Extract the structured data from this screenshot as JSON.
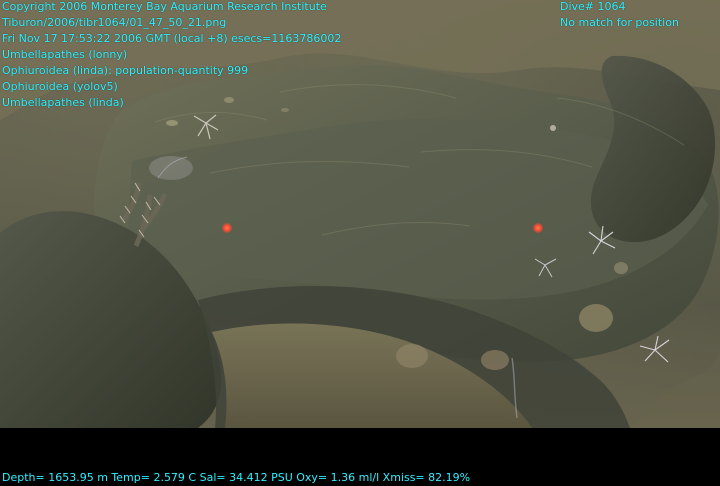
{
  "overlay": {
    "lines": [
      "Copyright 2006 Monterey Bay Aquarium Research Institute",
      "Tiburon/2006/tibr1064/01_47_50_21.png",
      "Fri Nov 17 17:53:22 2006 GMT (local +8)  esecs=1163786002",
      "Umbellapathes (lonny)",
      "Ophiuroidea (linda): population-quantity 999",
      "Ophiuroidea (yolov5)",
      "Umbellapathes (linda)"
    ],
    "right_lines": [
      "Dive# 1064",
      "No match for position"
    ],
    "bottom_line": "Depth= 1653.95 m  Temp= 2.579 C  Sal= 34.412 PSU  Oxy= 1.36 ml/l  Xmiss= 82.19%"
  },
  "colors": {
    "text": "#2EF0FF",
    "background": "#000000",
    "seafloor": "#66654F",
    "rock": "#4F5243",
    "laser": "#FF5A3A"
  }
}
